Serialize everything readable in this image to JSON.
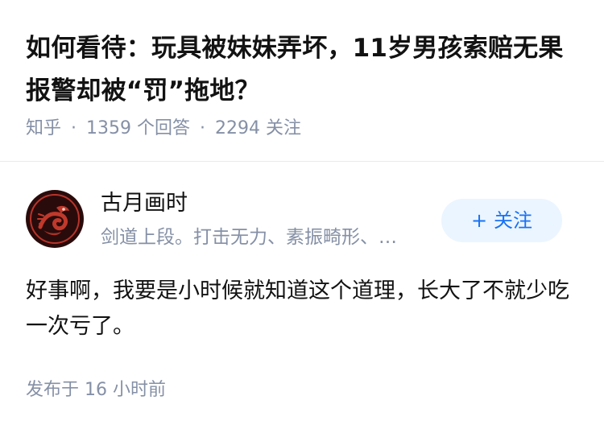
{
  "question": {
    "title": "如何看待：玩具被妹妹弄坏，11岁男孩索赔无果报警却被“罚”拖地？",
    "site": "知乎",
    "answer_count": "1359 个回答",
    "follower_count": "2294 关注",
    "separator": "·"
  },
  "author": {
    "name": "古月画时",
    "bio": "剑道上段。打击无力、素振畸形、…",
    "follow_label": "关注",
    "follow_plus": "+"
  },
  "answer": {
    "content": "好事啊，我要是小时候就知道这个道理，长大了不就少吃一次亏了。",
    "time": "发布于 16 小时前"
  },
  "colors": {
    "title": "#121212",
    "meta": "#8590a6",
    "follow_bg": "#ebf5ff",
    "follow_text": "#1772f6",
    "avatar_bg": "#2a0b0b",
    "avatar_art": "#c0392b"
  }
}
